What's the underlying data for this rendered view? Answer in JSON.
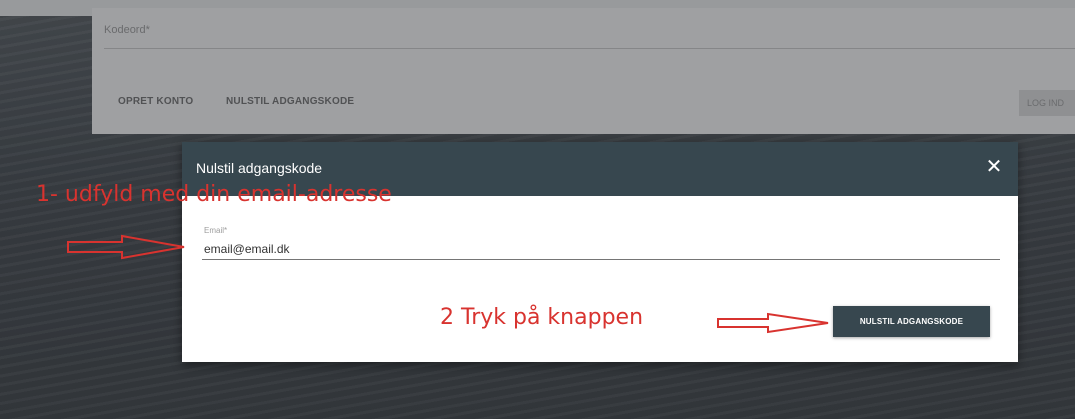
{
  "background_form": {
    "password_label": "Kodeord*",
    "create_account_link": "OPRET KONTO",
    "reset_password_link": "NULSTIL ADGANGSKODE",
    "login_button": "LOG IND"
  },
  "modal": {
    "title": "Nulstil adgangskode",
    "close_icon": "close-icon",
    "email_label": "Email*",
    "email_value": "email@email.dk",
    "submit_label": "NULSTIL ADGANGSKODE"
  },
  "annotations": {
    "step1": "1- udfyld med din email-adresse",
    "step2": "2 Tryk på knappen",
    "color": "#d8332f"
  },
  "colors": {
    "header": "#37474f",
    "button": "#37474f"
  }
}
